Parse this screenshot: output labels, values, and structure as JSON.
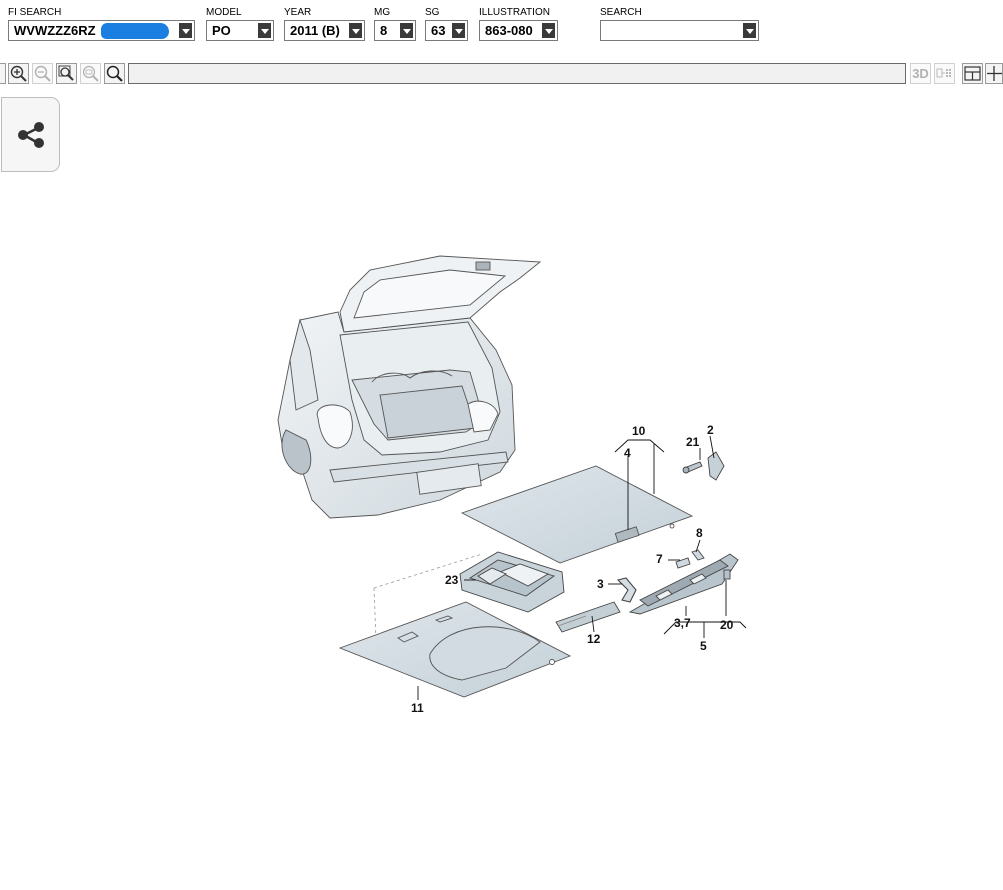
{
  "header": {
    "fi_search": {
      "label": "FI SEARCH",
      "value": "WVWZZZ6RZ"
    },
    "model": {
      "label": "MODEL",
      "value": "PO"
    },
    "year": {
      "label": "YEAR",
      "value": "2011 (B)"
    },
    "mg": {
      "label": "MG",
      "value": "8"
    },
    "sg": {
      "label": "SG",
      "value": "63"
    },
    "illustration": {
      "label": "ILLUSTRATION",
      "value": "863-080"
    },
    "search": {
      "label": "SEARCH",
      "value": ""
    }
  },
  "toolbar": {
    "icons": [
      "zoom-in-icon",
      "zoom-out-icon",
      "zoom-fit-icon",
      "zoom-100-icon",
      "magnifier-icon",
      "3d-view-icon",
      "grid-view-icon",
      "split-view-icon",
      "crosshair-icon"
    ],
    "label_3d": "3D"
  },
  "colors": {
    "accent_scribble": "#1a7fe0",
    "part_fill": "#cfd9e0",
    "arrow_bg": "#3a3a3a"
  },
  "diagram": {
    "callouts": {
      "c10": "10",
      "c2": "2",
      "c21": "21",
      "c4": "4",
      "c8": "8",
      "c7": "7",
      "c23": "23",
      "c3": "3",
      "c12": "12",
      "c37": "3,7",
      "c20": "20",
      "c5": "5",
      "c11": "11"
    }
  }
}
